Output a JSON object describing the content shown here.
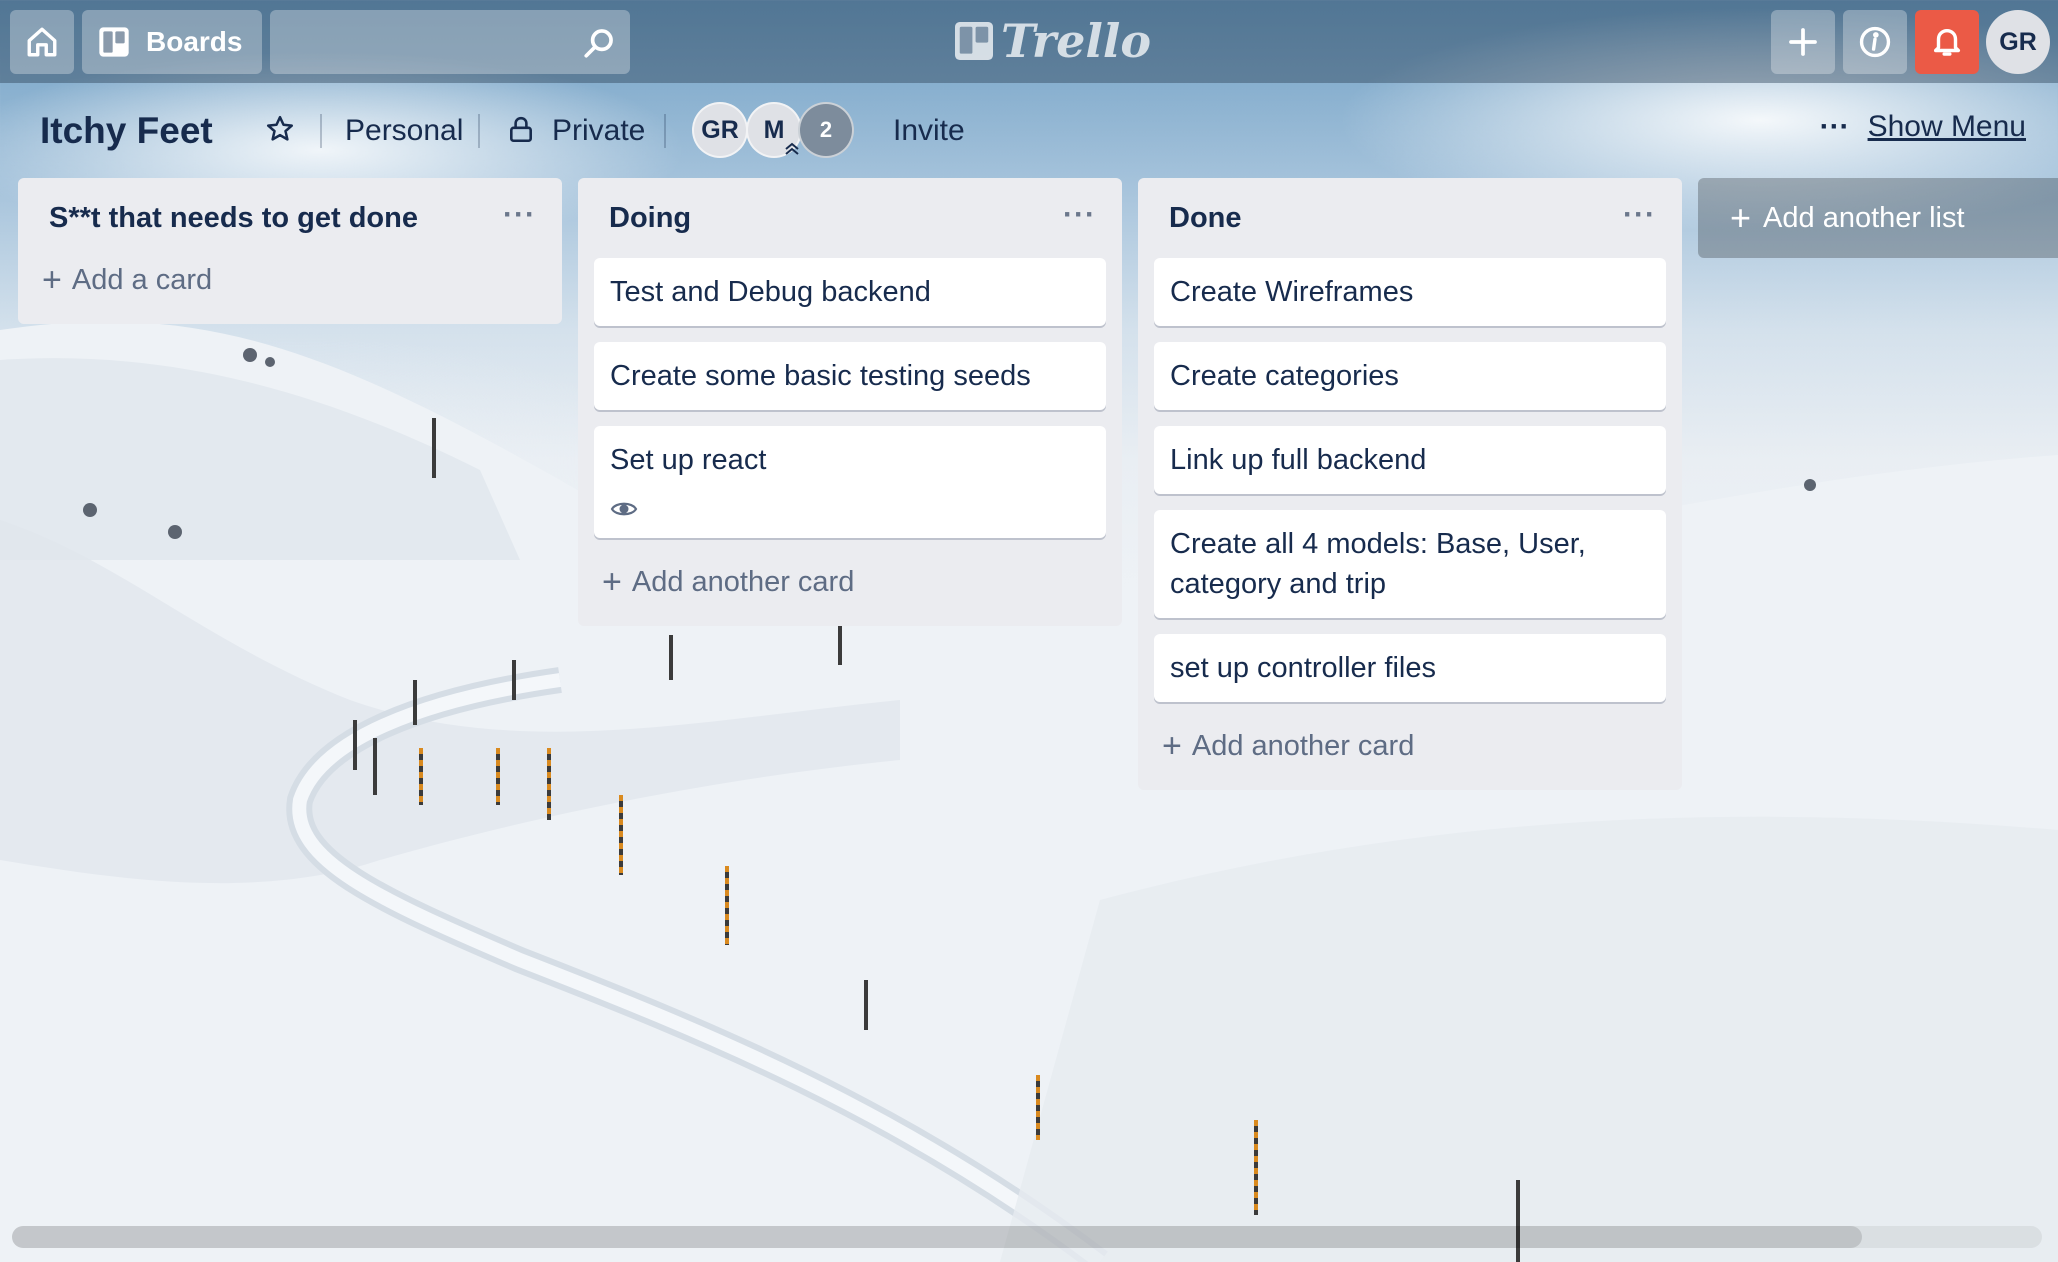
{
  "topbar": {
    "home_icon": "home-icon",
    "boards_label": "Boards",
    "search_placeholder": "",
    "logo_text": "Trello",
    "add_icon": "plus-icon",
    "info_icon": "info-icon",
    "notification_icon": "bell-icon",
    "notification_color": "#eb5a46",
    "avatar_initials": "GR"
  },
  "board": {
    "title": "Itchy Feet",
    "visibility_team": "Personal",
    "visibility": "Private",
    "members": [
      "GR",
      "M"
    ],
    "member_count": "2",
    "invite_label": "Invite",
    "show_menu_label": "Show Menu",
    "more_label": "···"
  },
  "lists": [
    {
      "title": "S**t that needs to get done",
      "menu": "···",
      "cards": [],
      "add_label": "Add a card"
    },
    {
      "title": "Doing",
      "menu": "···",
      "cards": [
        {
          "text": "Test and Debug backend"
        },
        {
          "text": "Create some basic testing seeds"
        },
        {
          "text": "Set up react",
          "badge": "eye-icon"
        }
      ],
      "add_label": "Add another card"
    },
    {
      "title": "Done",
      "menu": "···",
      "cards": [
        {
          "text": "Create Wireframes"
        },
        {
          "text": "Create categories"
        },
        {
          "text": "Link up full backend"
        },
        {
          "text": "Create all 4 models: Base, User, category and trip"
        },
        {
          "text": "set up controller files"
        }
      ],
      "add_label": "Add another card"
    }
  ],
  "add_list_label": "Add another list",
  "plus_glyph": "+"
}
